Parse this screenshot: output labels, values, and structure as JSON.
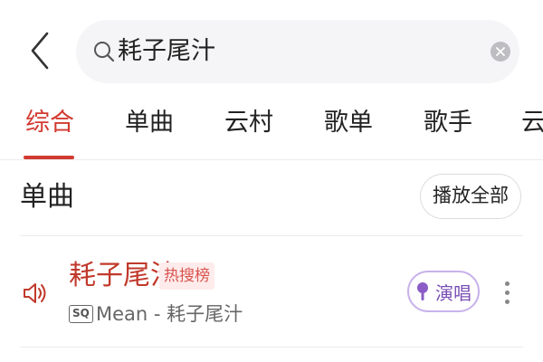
{
  "search": {
    "query": "耗子尾汁",
    "icons": {
      "back": "back-arrow-icon",
      "search": "search-icon",
      "clear": "clear-icon"
    }
  },
  "tabs": [
    {
      "label": "综合",
      "active": true
    },
    {
      "label": "单曲",
      "active": false
    },
    {
      "label": "云村",
      "active": false
    },
    {
      "label": "歌单",
      "active": false
    },
    {
      "label": "歌手",
      "active": false
    },
    {
      "label": "云",
      "active": false
    }
  ],
  "section": {
    "title": "单曲",
    "play_all_label": "播放全部"
  },
  "songs": [
    {
      "title": "耗子尾汁",
      "tag": "热搜榜",
      "quality_badge": "SQ",
      "meta": "Mean - 耗子尾汁",
      "sing_label": "演唱",
      "icons": {
        "playing": "speaker-icon",
        "sing": "microphone-icon",
        "more": "more-vertical-icon"
      }
    }
  ],
  "colors": {
    "accent": "#d33a31",
    "sing_border": "#c9b2ea",
    "sing_text": "#7a4fb6"
  }
}
